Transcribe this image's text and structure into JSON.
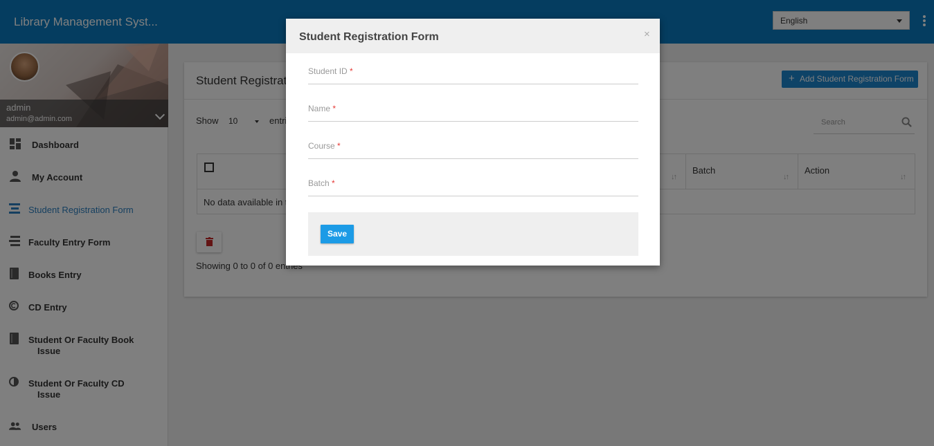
{
  "header": {
    "app_title": "Library Management Syst...",
    "language": "English"
  },
  "sidebar": {
    "profile": {
      "name": "admin",
      "email": "admin@admin.com"
    },
    "items": [
      {
        "label": "Dashboard",
        "icon": "dashboard-icon"
      },
      {
        "label": "My Account",
        "icon": "person-icon"
      },
      {
        "label": "Student Registration Form",
        "icon": "list-icon",
        "active": true
      },
      {
        "label": "Faculty Entry Form",
        "icon": "list-icon"
      },
      {
        "label": "Books Entry",
        "icon": "book-icon"
      },
      {
        "label": "CD Entry",
        "icon": "copyright-icon"
      },
      {
        "label": "Student Or Faculty Book",
        "label2": "Issue",
        "icon": "book-icon"
      },
      {
        "label": "Student Or Faculty CD",
        "label2": "Issue",
        "icon": "contrast-icon"
      },
      {
        "label": "Users",
        "icon": "people-icon"
      }
    ]
  },
  "panel": {
    "title": "Student Registrati",
    "add_button": "Add Student Registration Form",
    "show_label": "Show",
    "show_value": "10",
    "entries_label": "entri",
    "search_placeholder": "Search",
    "columns": [
      "Batch",
      "Action"
    ],
    "empty_text": "No data available in t",
    "showing": "Showing 0 to 0 of 0 entries"
  },
  "modal": {
    "title": "Student Registration Form",
    "close": "×",
    "fields": [
      {
        "label": "Student ID",
        "required": "*"
      },
      {
        "label": "Name",
        "required": "*"
      },
      {
        "label": "Course",
        "required": "*"
      },
      {
        "label": "Batch",
        "required": "*"
      }
    ],
    "save_label": "Save"
  },
  "colors": {
    "topbar": "#0b7bc1",
    "accent": "#2a7fc0",
    "save_button": "#1c9be6",
    "delete": "#c62828"
  }
}
